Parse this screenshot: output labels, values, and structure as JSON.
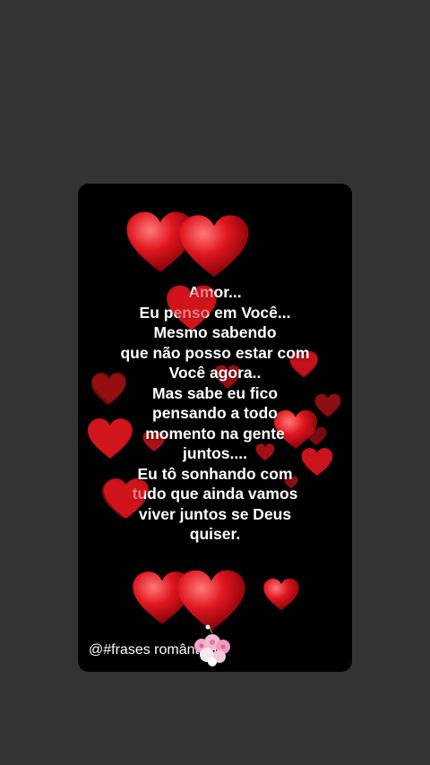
{
  "message": {
    "lines": [
      "Amor...",
      "Eu penso em Você...",
      "Mesmo sabendo",
      "que não posso estar com",
      "Você agora..",
      "Mas sabe eu fico",
      "pensando a todo",
      "momento na gente",
      "juntos....",
      "Eu tô sonhando com",
      "tudo que ainda vamos",
      "viver juntos se Deus",
      "quiser."
    ]
  },
  "watermark": "@#frases românticas",
  "colors": {
    "background": "#333333",
    "card": "#000000",
    "heart": "#d8141c",
    "text": "#ffffff"
  },
  "decorations": {
    "hearts_icon": "heart-icon",
    "flowers_icon": "flower-bouquet-icon"
  }
}
